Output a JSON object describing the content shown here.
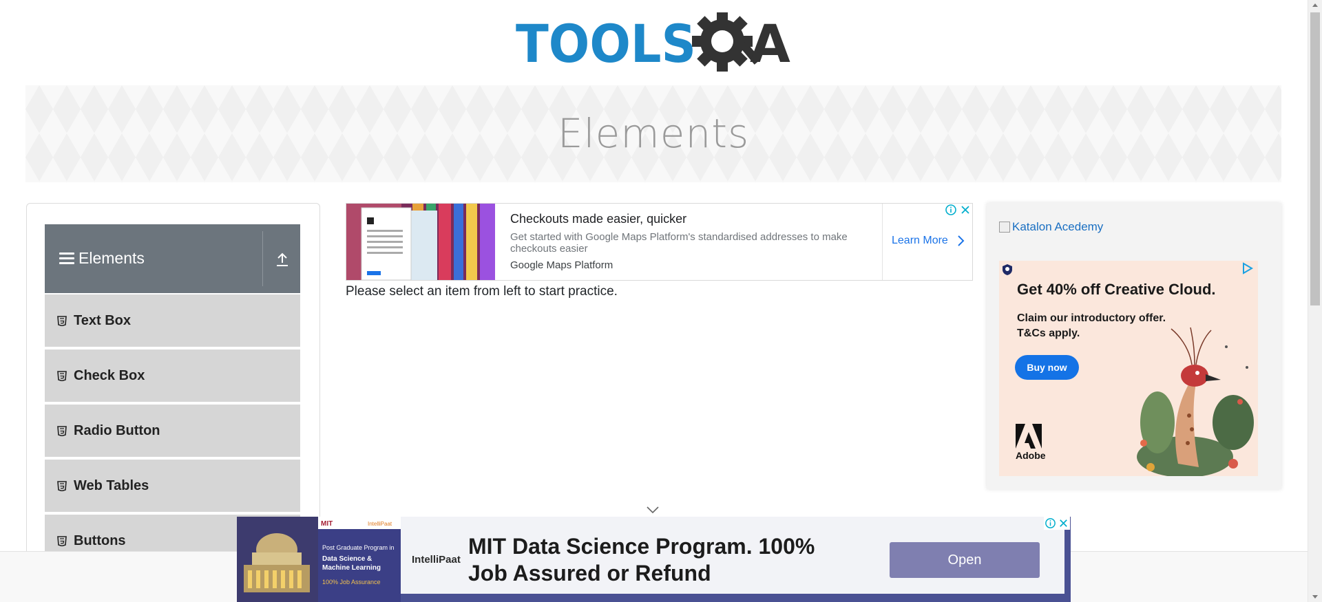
{
  "header": {
    "logo_text": "TOOLSQA",
    "page_title": "Elements"
  },
  "sidebar": {
    "group_title": "Elements",
    "items": [
      {
        "label": "Text Box"
      },
      {
        "label": "Check Box"
      },
      {
        "label": "Radio Button"
      },
      {
        "label": "Web Tables"
      },
      {
        "label": "Buttons"
      }
    ]
  },
  "top_ad": {
    "headline": "Checkouts made easier, quicker",
    "description": "Get started with Google Maps Platform's standardised addresses to make checkouts easier",
    "source": "Google Maps Platform",
    "cta": "Learn More"
  },
  "main": {
    "message": "Please select an item from left to start practice."
  },
  "right_column": {
    "broken_image_alt": "Katalon Acedemy",
    "cc_ad": {
      "headline": "Get 40% off Creative Cloud.",
      "line1": "Claim our introductory offer.",
      "line2": "T&Cs apply.",
      "button": "Buy now",
      "brand": "Adobe"
    }
  },
  "bottom_ad": {
    "img_badge": "MIT",
    "img_badge2": "IntelliPaat",
    "img_line1": "Post Graduate Program in",
    "img_line2": "Data Science &",
    "img_line3": "Machine Learning",
    "img_line4": "100% Job Assurance",
    "logo": "IntelliPaat",
    "headline": "MIT Data Science Program. 100% Job Assured or Refund",
    "button": "Open"
  },
  "colors": {
    "logo_blue": "#1e88c9",
    "logo_dark": "#333333",
    "sidebar_header": "#6c757d",
    "sidebar_item": "#d6d6d6",
    "link_blue": "#1a73e8",
    "adobe_button": "#1473e6",
    "bottom_ad_bg": "#4a5193"
  }
}
